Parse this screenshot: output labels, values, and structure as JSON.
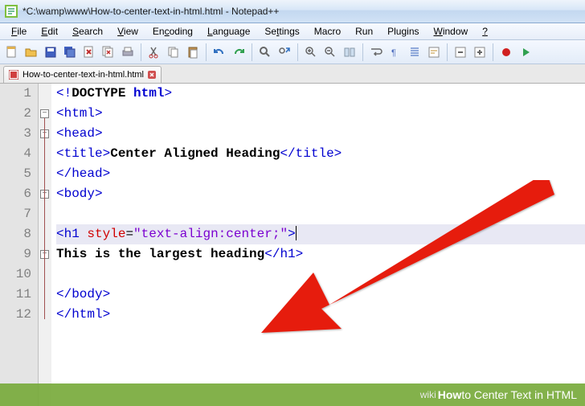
{
  "titlebar": {
    "title": "*C:\\wamp\\www\\How-to-center-text-in-html.html - Notepad++"
  },
  "menubar": {
    "items": [
      "File",
      "Edit",
      "Search",
      "View",
      "Encoding",
      "Language",
      "Settings",
      "Macro",
      "Run",
      "Plugins",
      "Window",
      "?"
    ]
  },
  "toolbar": {
    "buttons": [
      "new",
      "open",
      "save",
      "save-all",
      "close",
      "close-all",
      "print",
      "cut",
      "copy",
      "paste",
      "undo",
      "redo",
      "find",
      "replace",
      "zoom-in",
      "zoom-out",
      "sync",
      "wrap",
      "show-all",
      "indent",
      "lang",
      "fold",
      "unfold",
      "rec",
      "play"
    ]
  },
  "tab": {
    "label": "How-to-center-text-in-html.html"
  },
  "gutter": {
    "lines": [
      "1",
      "2",
      "3",
      "4",
      "5",
      "6",
      "7",
      "8",
      "9",
      "10",
      "11",
      "12"
    ]
  },
  "code": {
    "l1_open": "<!",
    "l1_doc": "DOCTYPE",
    "l1_sp": " ",
    "l1_html": "html",
    "l1_close": ">",
    "l2": "<html>",
    "l3": "<head>",
    "l4_open": "<title>",
    "l4_txt": "Center Aligned Heading",
    "l4_close": "</title>",
    "l5": "</head>",
    "l6": "<body>",
    "l8_open": "<",
    "l8_tag": "h1 ",
    "l8_attr": "style",
    "l8_eq": "=",
    "l8_str": "\"text-align:center;\"",
    "l8_close": ">",
    "l9_txt": "This is the largest heading",
    "l9_close": "</h1>",
    "l11": "</body>",
    "l12": "</html>"
  },
  "footer": {
    "brand": "wiki",
    "text1": "How",
    "text2": " to Center Text in HTML"
  }
}
